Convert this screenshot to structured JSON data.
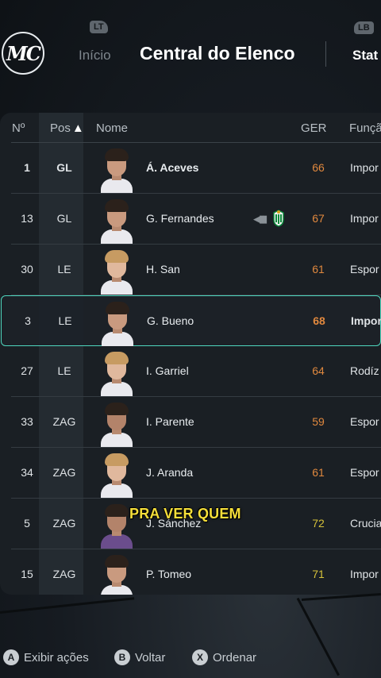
{
  "header": {
    "logo_text": "MC",
    "lt_tag": "LT",
    "lb_tag": "LB",
    "tabs": [
      {
        "label": "Início",
        "active": false
      },
      {
        "label": "Central do Elenco",
        "active": true
      },
      {
        "label": "Stat",
        "active": false
      }
    ]
  },
  "table": {
    "columns": {
      "num": "Nº",
      "pos": "Pos",
      "sort_indicator": "▲",
      "name": "Nome",
      "ger": "GER",
      "func": "Funçã"
    },
    "rows": [
      {
        "num": "1",
        "pos": "GL",
        "name": "Á. Aceves",
        "ger": "66",
        "func": "Impor",
        "bold": true
      },
      {
        "num": "13",
        "pos": "GL",
        "name": "G. Fernandes",
        "ger": "67",
        "func": "Impor"
      },
      {
        "num": "30",
        "pos": "LE",
        "name": "H. San",
        "ger": "61",
        "func": "Espor"
      },
      {
        "num": "3",
        "pos": "LE",
        "name": "G. Bueno",
        "ger": "68",
        "func": "Impor",
        "selected": true
      },
      {
        "num": "27",
        "pos": "LE",
        "name": "I. Garriel",
        "ger": "64",
        "func": "Rodíz"
      },
      {
        "num": "33",
        "pos": "ZAG",
        "name": "I. Parente",
        "ger": "59",
        "func": "Espor"
      },
      {
        "num": "34",
        "pos": "ZAG",
        "name": "J. Aranda",
        "ger": "61",
        "func": "Espor"
      },
      {
        "num": "5",
        "pos": "ZAG",
        "name": "J. Sánchez",
        "ger": "72",
        "func": "Crucia"
      },
      {
        "num": "15",
        "pos": "ZAG",
        "name": "P. Tomeo",
        "ger": "71",
        "func": "Impor"
      }
    ],
    "loan_icon": "loan-arrow-icon",
    "club_badge_icon": "real-betis-badge-icon"
  },
  "caption": "PRA VER QUEM",
  "hints": [
    {
      "button": "A",
      "label": "Exibir ações"
    },
    {
      "button": "B",
      "label": "Voltar"
    },
    {
      "button": "X",
      "label": "Ordenar"
    }
  ],
  "colors": {
    "accent": "#4fd6be",
    "rating_orange": "#e0883e",
    "rating_yellow": "#d6c23a",
    "caption": "#f5df3a"
  }
}
